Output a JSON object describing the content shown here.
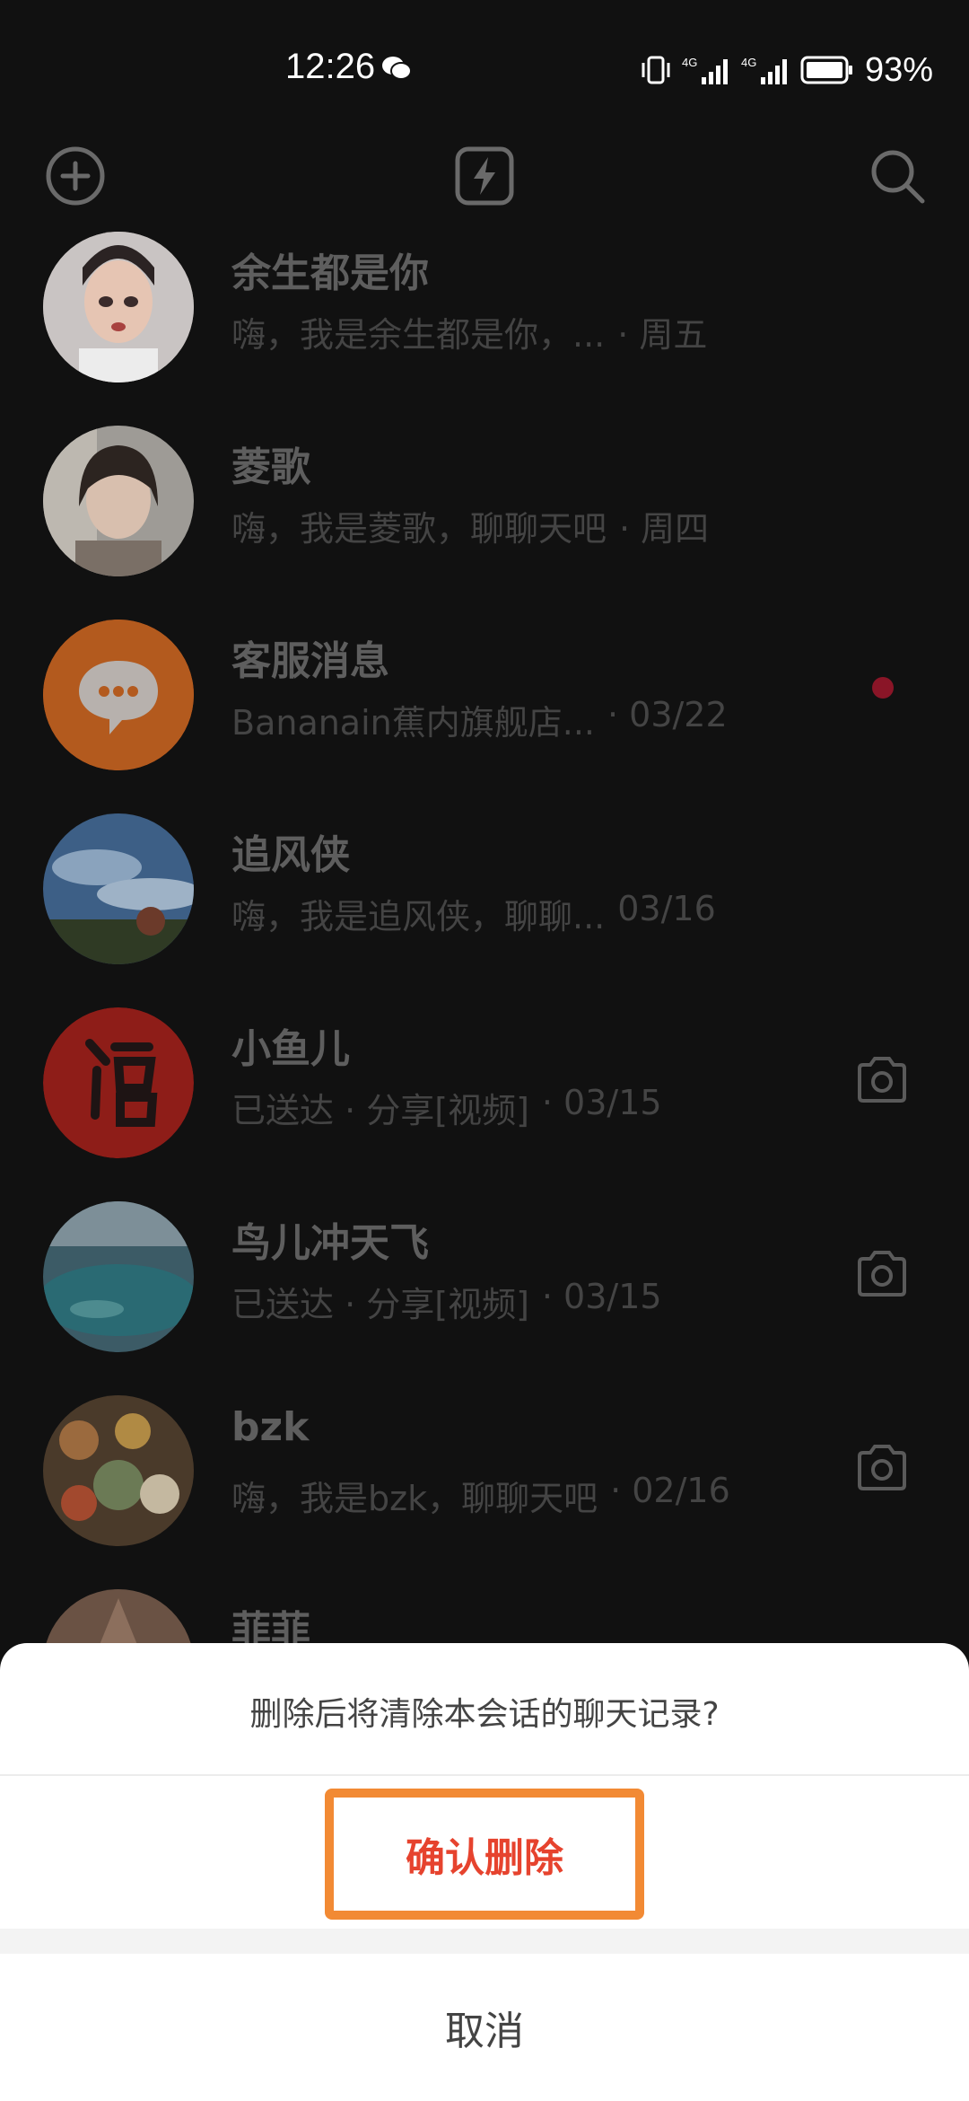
{
  "status_bar": {
    "time": "12:26",
    "battery_percent": "93%"
  },
  "toolbar": {
    "icons": [
      "plus-icon",
      "flash-icon",
      "search-icon"
    ]
  },
  "conversations": [
    {
      "name": "余生都是你",
      "preview": "嗨，我是余生都是你，...",
      "time": "· 周五",
      "trailing": ""
    },
    {
      "name": "菱歌",
      "preview": "嗨，我是菱歌，聊聊天吧",
      "time": "· 周四",
      "trailing": ""
    },
    {
      "name": "客服消息",
      "preview": "Bananain蕉内旗舰店...",
      "time": "· 03/22",
      "trailing": "unread-dot"
    },
    {
      "name": "追风侠",
      "preview": "嗨，我是追风侠，聊聊...",
      "time": "03/16",
      "trailing": ""
    },
    {
      "name": "小鱼儿",
      "preview": "已送达 · 分享[视频]",
      "time": "· 03/15",
      "trailing": "camera-icon"
    },
    {
      "name": "鸟儿冲天飞",
      "preview": "已送达 · 分享[视频]",
      "time": "· 03/15",
      "trailing": "camera-icon"
    },
    {
      "name": "bzk",
      "preview": "嗨，我是bzk，聊聊天吧",
      "time": "· 02/16",
      "trailing": "camera-icon"
    },
    {
      "name": "菲菲",
      "preview": "",
      "time": "",
      "trailing": ""
    }
  ],
  "sheet": {
    "message": "删除后将清除本会话的聊天记录?",
    "confirm_label": "确认删除",
    "cancel_label": "取消"
  },
  "colors": {
    "confirm_text": "#e6432e",
    "highlight_border": "#f28a34",
    "unread_dot": "#8a1527"
  }
}
